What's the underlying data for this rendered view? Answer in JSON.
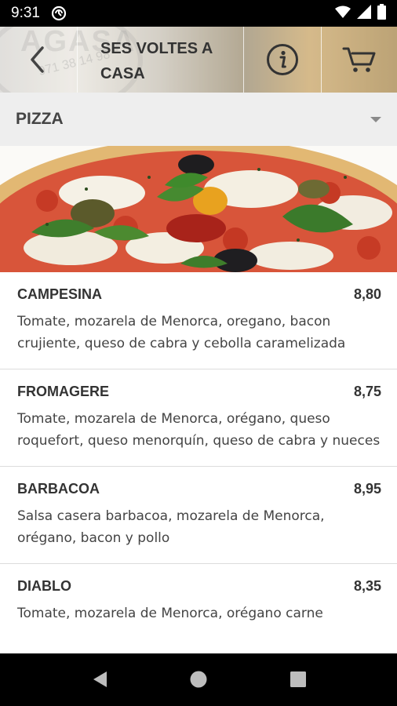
{
  "status": {
    "time": "9:31"
  },
  "header": {
    "title": "SES VOLTES A CASA",
    "bg_text": "AGASA",
    "bg_phone": "971 38 14 98"
  },
  "category": {
    "label": "PIZZA"
  },
  "menu": {
    "items": [
      {
        "name": "CAMPESINA",
        "price": "8,80",
        "description": "Tomate, mozarela de Menorca, oregano, bacon crujiente, queso de cabra y cebolla caramelizada"
      },
      {
        "name": "FROMAGERE",
        "price": "8,75",
        "description": "Tomate, mozarela de Menorca, orégano, queso roquefort, queso menorquín, queso de cabra y nueces"
      },
      {
        "name": "BARBACOA",
        "price": "8,95",
        "description": "Salsa casera barbacoa, mozarela de Menorca, orégano, bacon y pollo"
      },
      {
        "name": "DIABLO",
        "price": "8,35",
        "description": "Tomate, mozarela de Menorca, orégano carne"
      }
    ]
  },
  "icons": {
    "status_left": "notification-icon",
    "wifi": "wifi-icon",
    "signal": "signal-icon",
    "battery": "battery-icon",
    "back": "back-arrow-icon",
    "info": "info-icon",
    "cart": "cart-icon",
    "caret": "caret-down-icon",
    "nav_back": "nav-back-icon",
    "nav_home": "nav-home-icon",
    "nav_recents": "nav-recents-icon"
  },
  "colors": {
    "header_text": "#333333",
    "category_bg": "#eeeeee",
    "status_bg": "#000000"
  }
}
